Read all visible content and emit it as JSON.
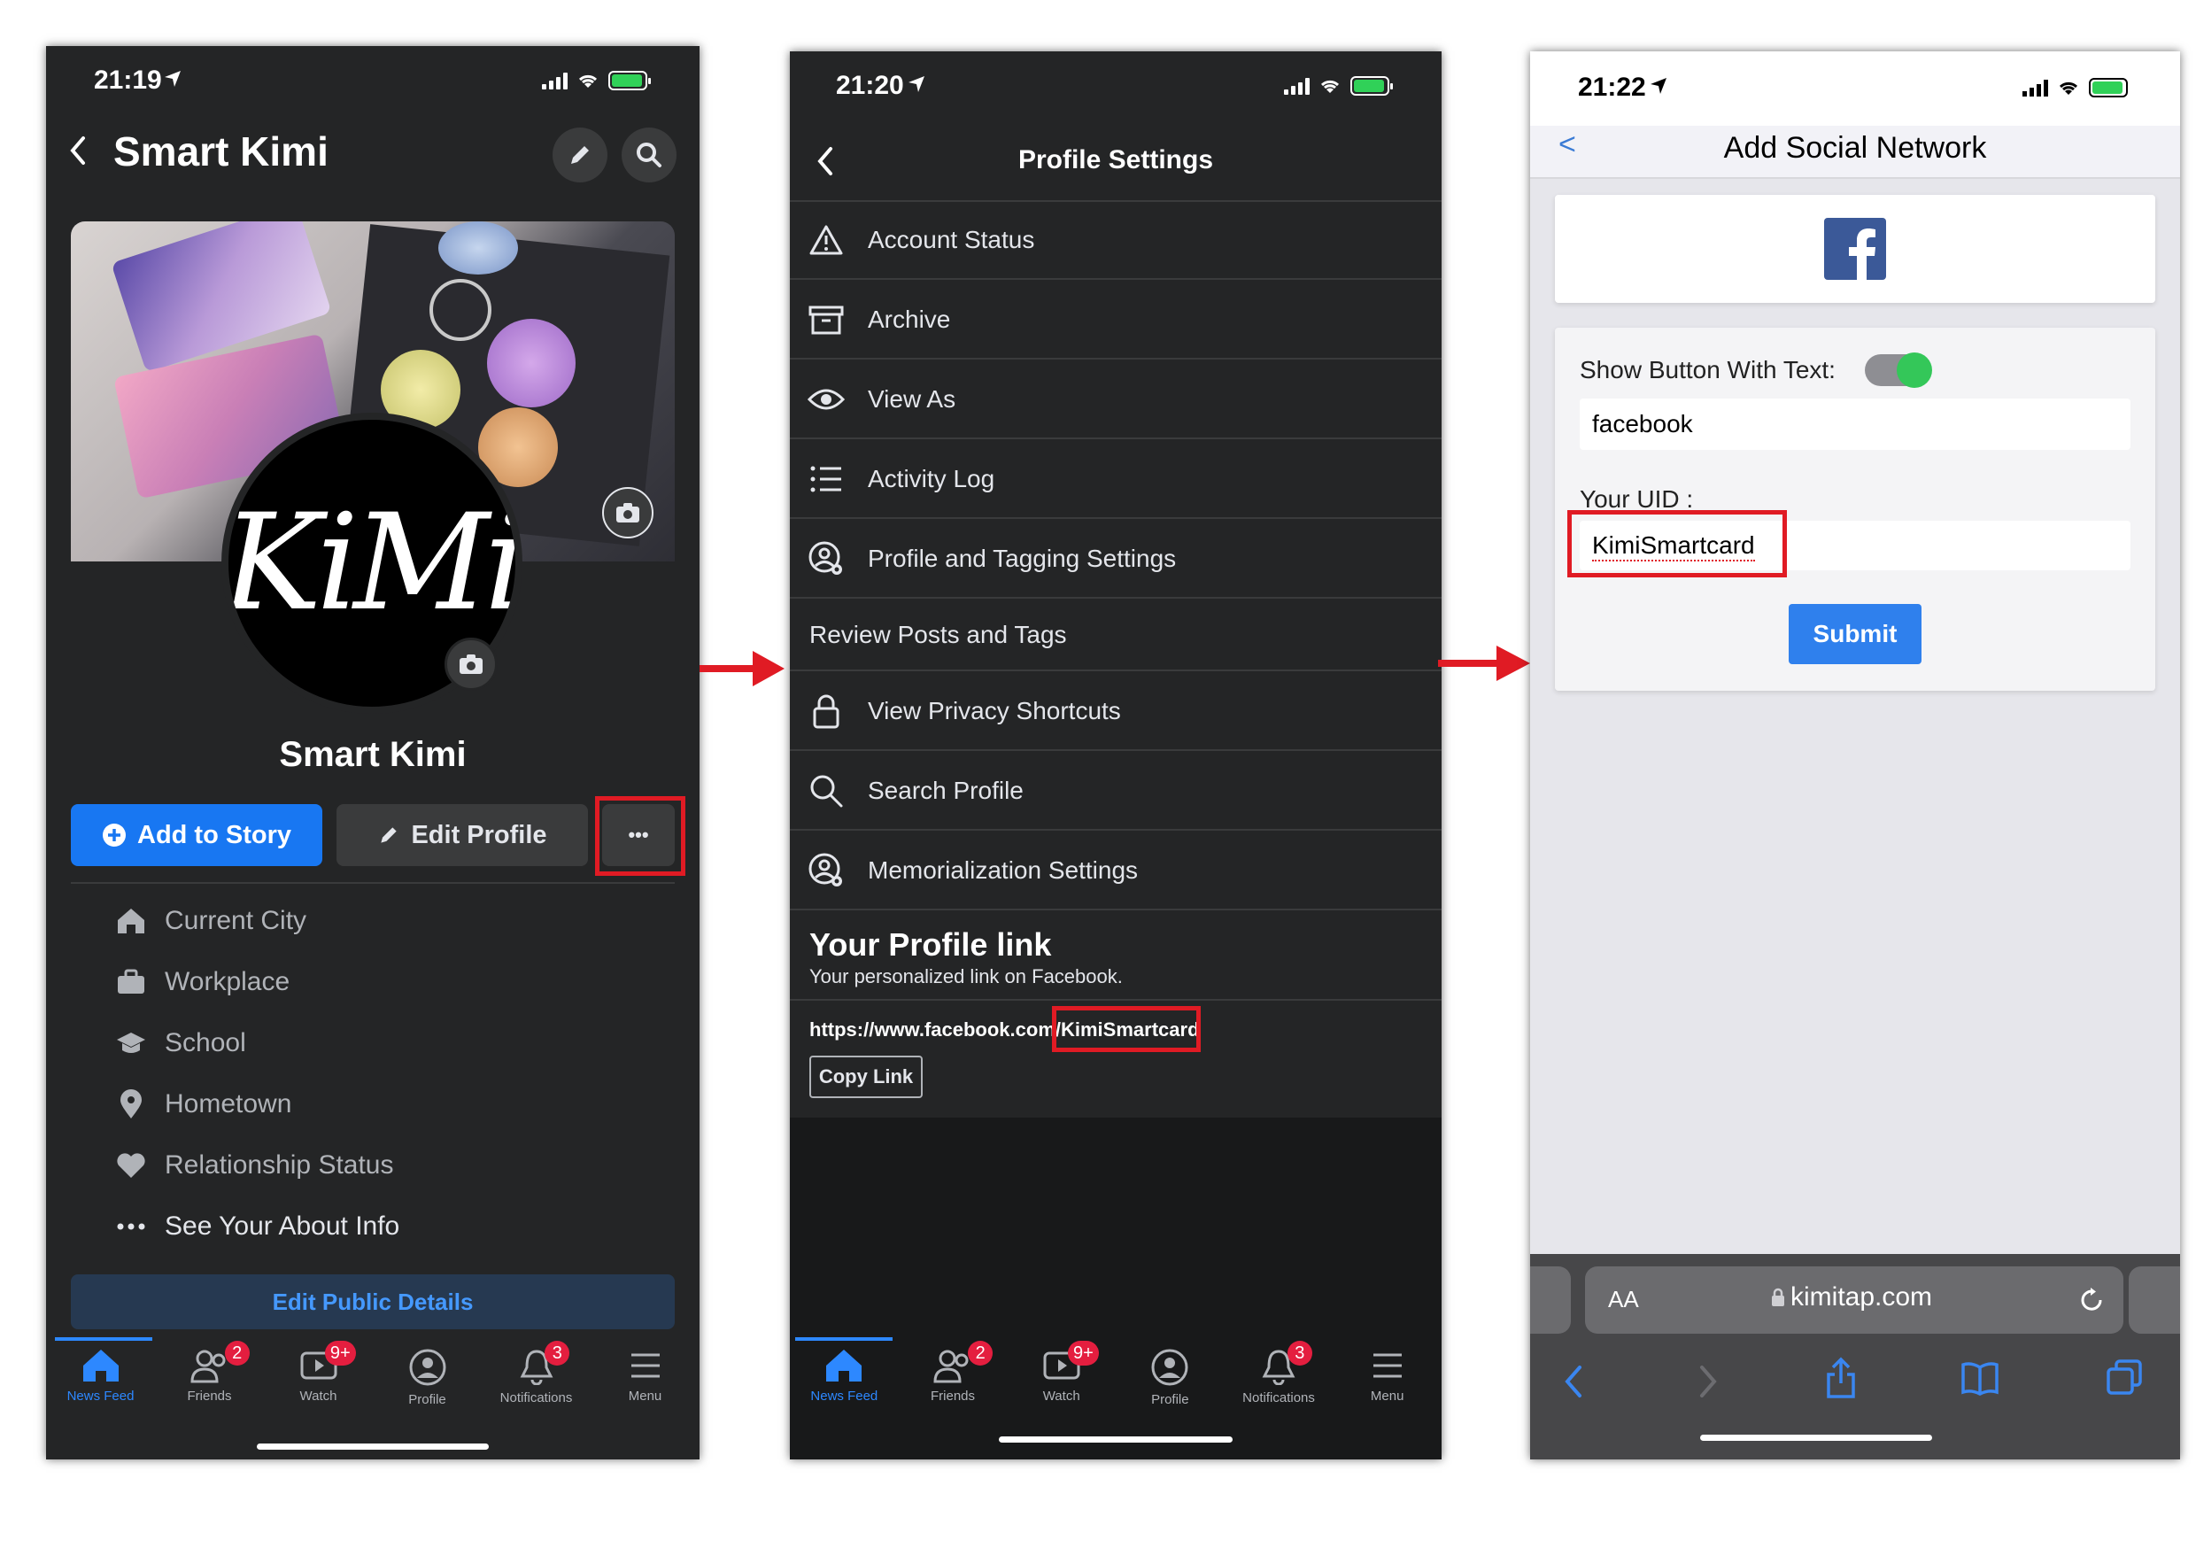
{
  "panel1": {
    "status_time": "21:19",
    "header_title": "Smart Kimi",
    "cover_logo_text": "KiMi",
    "profile_name": "Smart Kimi",
    "add_story_label": "Add to Story",
    "edit_profile_label": "Edit Profile",
    "more_label": "•••",
    "info_items": [
      "Current City",
      "Workplace",
      "School",
      "Hometown",
      "Relationship Status",
      "See Your About Info"
    ],
    "edit_public_label": "Edit Public Details"
  },
  "panel2": {
    "status_time": "21:20",
    "header_title": "Profile Settings",
    "menu_items": [
      "Account Status",
      "Archive",
      "View As",
      "Activity Log",
      "Profile and Tagging Settings",
      "Review Posts and Tags",
      "View Privacy Shortcuts",
      "Search Profile",
      "Memorialization Settings"
    ],
    "profile_link_title": "Your Profile link",
    "profile_link_subtitle": "Your personalized link on Facebook.",
    "link_prefix": "https://www.facebook.com/",
    "link_username": "KimiSmartcard",
    "copy_link_label": "Copy Link"
  },
  "bottom_nav": {
    "items": [
      "News Feed",
      "Friends",
      "Watch",
      "Profile",
      "Notifications",
      "Menu"
    ],
    "badges": {
      "friends": "2",
      "watch": "9+",
      "notifications": "3"
    }
  },
  "panel3": {
    "status_time": "21:22",
    "header_title": "Add Social Network",
    "back_label": "<",
    "show_button_label": "Show Button With Text:",
    "button_text_value": "facebook",
    "uid_label": "Your UID :",
    "uid_value": "KimiSmartcard",
    "submit_label": "Submit",
    "url_aa": "AA",
    "url_domain": "kimitap.com"
  },
  "colors": {
    "fb_blue": "#1877f2",
    "highlight_red": "#e01b24",
    "toggle_green": "#34c759",
    "dark_bg": "#242526"
  }
}
